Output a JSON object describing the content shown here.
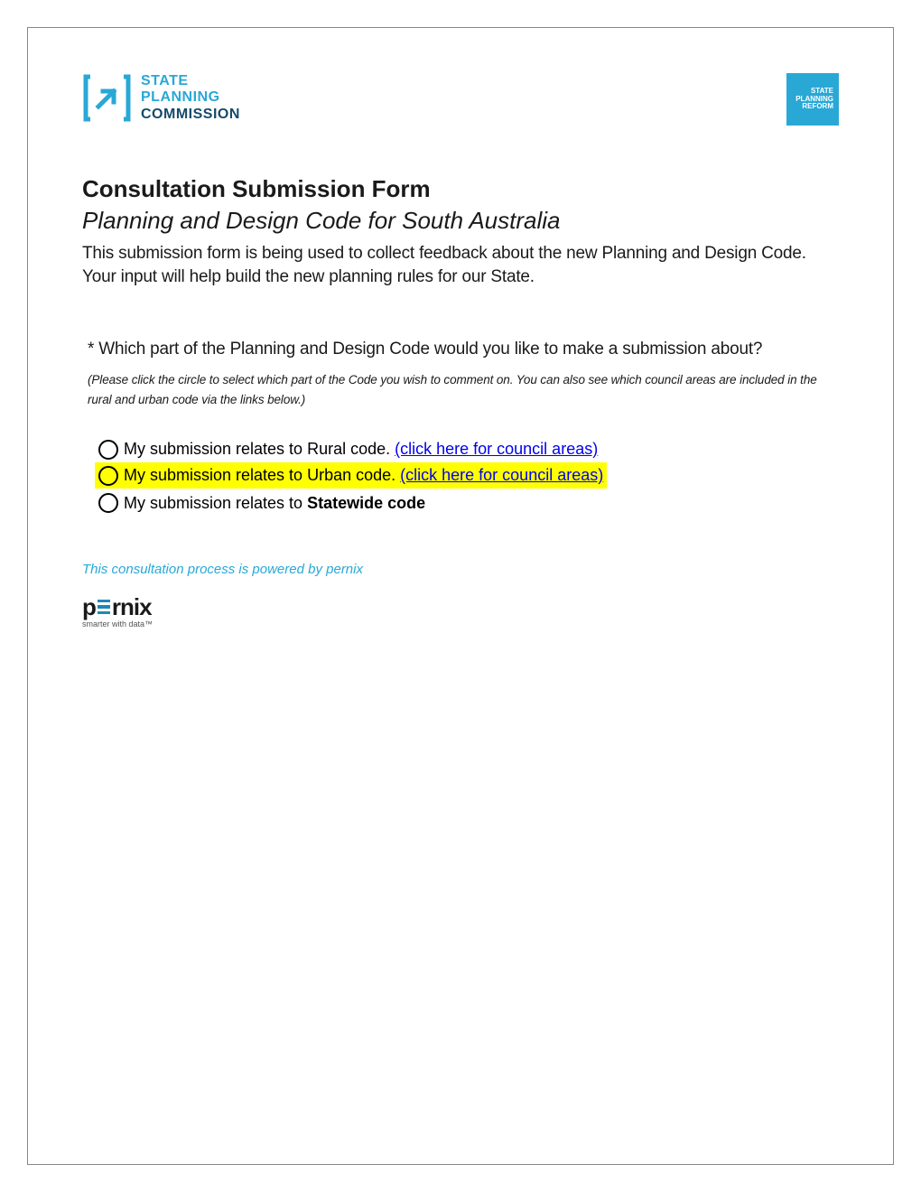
{
  "logos": {
    "spc": {
      "line1": "STATE",
      "line2": "PLANNING",
      "line3": "COMMISSION"
    },
    "reform": {
      "line1": "STATE",
      "line2": "PLANNING",
      "line3": "REFORM"
    }
  },
  "title": "Consultation Submission Form",
  "subtitle": "Planning and Design Code for South Australia",
  "intro": "This submission form is being used to collect feedback about the new Planning and Design Code. Your input will help build the new planning rules for our State.",
  "question": {
    "prefix": "* ",
    "text": "Which part of the Planning and Design Code would you like to make a submission about?",
    "hint": "(Please click the circle to select which part of the Code you wish to comment on. You can also see which council areas are included in the rural and urban code via the links below.)"
  },
  "options": [
    {
      "label": "My submission relates to Rural code. ",
      "link": "(click here for council areas)",
      "highlight": false
    },
    {
      "label": "My submission relates to Urban code. ",
      "link": "(click here for council areas)",
      "highlight": true
    },
    {
      "label_pre": "My submission relates to ",
      "label_bold": "Statewide code",
      "highlight": false
    }
  ],
  "footer": {
    "note": "This consultation process is powered by pernix",
    "pernix_tag": "smarter with data™"
  }
}
